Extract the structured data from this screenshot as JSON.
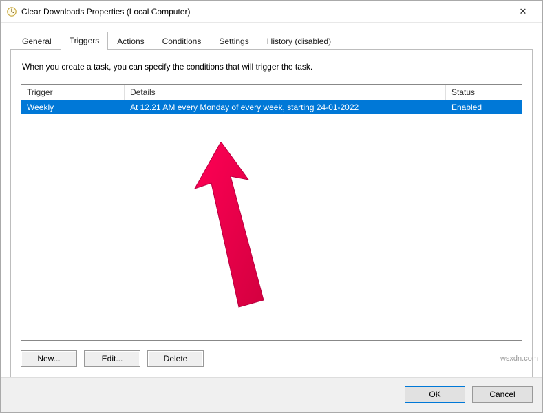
{
  "window": {
    "title": "Clear Downloads Properties (Local Computer)",
    "close_glyph": "✕"
  },
  "tabs": [
    {
      "label": "General"
    },
    {
      "label": "Triggers"
    },
    {
      "label": "Actions"
    },
    {
      "label": "Conditions"
    },
    {
      "label": "Settings"
    },
    {
      "label": "History (disabled)"
    }
  ],
  "active_tab_index": 1,
  "triggers_panel": {
    "intro": "When you create a task, you can specify the conditions that will trigger the task.",
    "columns": {
      "trigger": "Trigger",
      "details": "Details",
      "status": "Status"
    },
    "rows": [
      {
        "trigger": "Weekly",
        "details": "At 12.21 AM every Monday of every week, starting 24-01-2022",
        "status": "Enabled"
      }
    ],
    "buttons": {
      "new": "New...",
      "edit": "Edit...",
      "delete": "Delete"
    }
  },
  "footer": {
    "ok": "OK",
    "cancel": "Cancel"
  },
  "colors": {
    "selection": "#0078d7",
    "accent_border": "#0078d7"
  },
  "watermark": "wsxdn.com"
}
